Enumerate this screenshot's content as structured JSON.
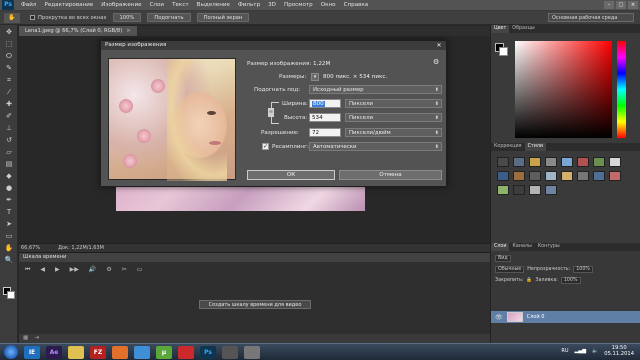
{
  "app": {
    "logo": "Ps",
    "menu": [
      "Файл",
      "Редактирование",
      "Изображение",
      "Слои",
      "Текст",
      "Выделение",
      "Фильтр",
      "3D",
      "Просмотр",
      "Окно",
      "Справка"
    ],
    "window_controls": [
      "–",
      "□",
      "×"
    ]
  },
  "options_bar": {
    "checkbox_label": "Прокрутка во всех окнах",
    "btn_100": "100%",
    "btn_fit": "Подогнать",
    "btn_fullscreen": "Полный экран",
    "workspace": "Основная рабочая среда"
  },
  "document": {
    "tab_label": "Lena1.jpeg @ 66,7% (Слой 0, RGB/8)",
    "close": "×",
    "zoom": "66,67%",
    "doc_info": "Док: 1,22M/1,63M"
  },
  "timeline": {
    "title": "Шкала времени",
    "create_button": "Создать шкалу времени для видео",
    "transport_icons": [
      "⏮",
      "◀",
      "▶",
      "▶▶",
      "🔊",
      "⚙",
      "✂",
      "▭"
    ]
  },
  "right_panels": {
    "color_tabs": [
      "Цвет",
      "Образцы"
    ],
    "styles_tabs": [
      "Коррекция",
      "Стили"
    ],
    "layers_tabs": [
      "Слои",
      "Каналы",
      "Контуры"
    ],
    "layer_filter": "Вид",
    "blend_mode": "Обычные",
    "opacity_label": "Непрозрачность:",
    "opacity_value": "100%",
    "lock_label": "Закрепить:",
    "fill_label": "Заливка:",
    "fill_value": "100%",
    "layer_name": "Слой 0"
  },
  "dialog": {
    "title": "Размер изображения",
    "size_label": "Размер изображения:",
    "size_value": "1,22M",
    "dims_label": "Размеры:",
    "dims_value": "800 пикс. × 534 пикс.",
    "fit_label": "Подогнать под:",
    "fit_value": "Исходный размер",
    "width_label": "Ширина:",
    "width_value": "800",
    "width_unit": "Пиксели",
    "height_label": "Высота:",
    "height_value": "534",
    "height_unit": "Пиксели",
    "resolution_label": "Разрешение:",
    "resolution_value": "72",
    "resolution_unit": "Пиксели/дюйм",
    "resample_label": "Ресамплинг:",
    "resample_value": "Автоматически",
    "ok": "ОК",
    "cancel": "Отмена",
    "resample_checked": true
  },
  "taskbar": {
    "apps": [
      "IE",
      "Ae",
      "",
      "FZ",
      "",
      "",
      "µ",
      "",
      "Ps",
      "",
      ""
    ],
    "language": "RU",
    "time": "19:50",
    "date": "05.11.2014"
  },
  "colors": {
    "accent": "#3d7fd6",
    "layer_selected": "#5f7fa6"
  }
}
